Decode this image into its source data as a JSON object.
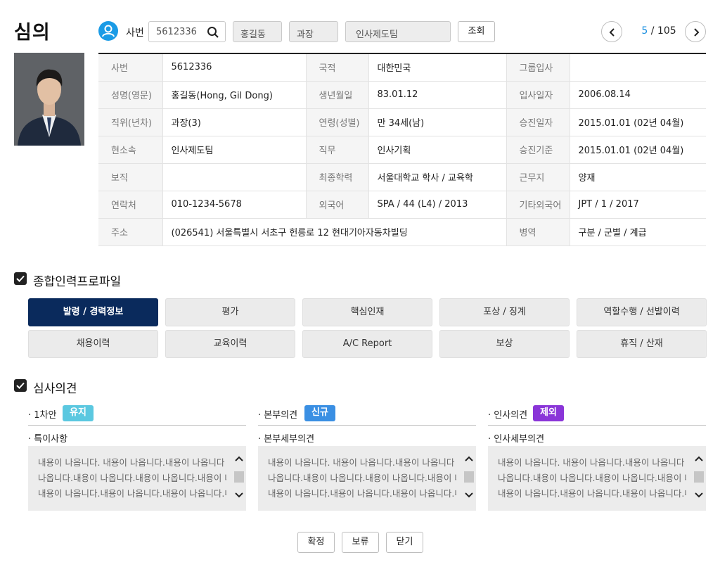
{
  "header": {
    "title": "심의",
    "emp_label": "사번",
    "emp_no": "5612336",
    "name": "홍길동",
    "position": "과장",
    "team": "인사제도팀",
    "search_btn": "조회",
    "pager": {
      "current": "5",
      "sep": " / ",
      "total": "105"
    }
  },
  "info": {
    "rows": [
      [
        {
          "l": "사번",
          "v": "5612336"
        },
        {
          "l": "국적",
          "v": "대한민국"
        },
        {
          "l": "그룹입사",
          "v": ""
        }
      ],
      [
        {
          "l": "성명(영문)",
          "v": "홍길동(Hong, Gil Dong)"
        },
        {
          "l": "생년월일",
          "v": "83.01.12"
        },
        {
          "l": "입사일자",
          "v": "2006.08.14"
        }
      ],
      [
        {
          "l": "직위(년차)",
          "v": "과장(3)"
        },
        {
          "l": "연령(성별)",
          "v": "만 34세(남)"
        },
        {
          "l": "승진일자",
          "v": "2015.01.01 (02년 04월)"
        }
      ],
      [
        {
          "l": "현소속",
          "v": "인사제도팀"
        },
        {
          "l": "직무",
          "v": "인사기획"
        },
        {
          "l": "승진기준",
          "v": "2015.01.01 (02년 04월)"
        }
      ],
      [
        {
          "l": "보직",
          "v": ""
        },
        {
          "l": "최종학력",
          "v": "서울대학교 학사 / 교육학"
        },
        {
          "l": "근무지",
          "v": "양재"
        }
      ],
      [
        {
          "l": "연락처",
          "v": "010-1234-5678"
        },
        {
          "l": "외국어",
          "v": "SPA / 44 (L4) / 2013"
        },
        {
          "l": "기타외국어",
          "v": "JPT / 1 / 2017"
        }
      ]
    ],
    "address_label": "주소",
    "address": "(026541) 서울특별시 서초구 헌릉로 12 현대기아자동차빌딩",
    "military_label": "병역",
    "military": "구분 / 군별 / 계급"
  },
  "profile": {
    "title": "종합인력프로파일",
    "tabs": [
      "발령 / 경력정보",
      "평가",
      "핵심인재",
      "포상 / 징계",
      "역할수행 / 선발이력",
      "채용이력",
      "교육이력",
      "A/C Report",
      "보상",
      "휴직 / 산재"
    ],
    "active_tab": "발령 / 경력정보"
  },
  "review": {
    "title": "심사의견",
    "cols": [
      {
        "head": "1차안",
        "badge": "유지",
        "badge_color": "#5bc8e0",
        "sub": "특이사항"
      },
      {
        "head": "본부의견",
        "badge": "신규",
        "badge_color": "#3a8fe3",
        "sub": "본부세부의견"
      },
      {
        "head": "인사의견",
        "badge": "제외",
        "badge_color": "#8a35d8",
        "sub": "인사세부의견"
      }
    ],
    "text_lines": [
      "내용이 나옵니다. 내용이 나옵니다.내용이 나옵니다",
      "나옵니다.내용이 나옵니다.내용이 나옵니다.내용이 나옵니다",
      "내용이 나옵니다.내용이 나옵니다.내용이 나옵니다.내용이 나옵니다"
    ]
  },
  "actions": {
    "confirm": "확정",
    "hold": "보류",
    "close": "닫기"
  },
  "colors": {
    "accent": "#1a9be6",
    "navy": "#0a2a5c"
  }
}
